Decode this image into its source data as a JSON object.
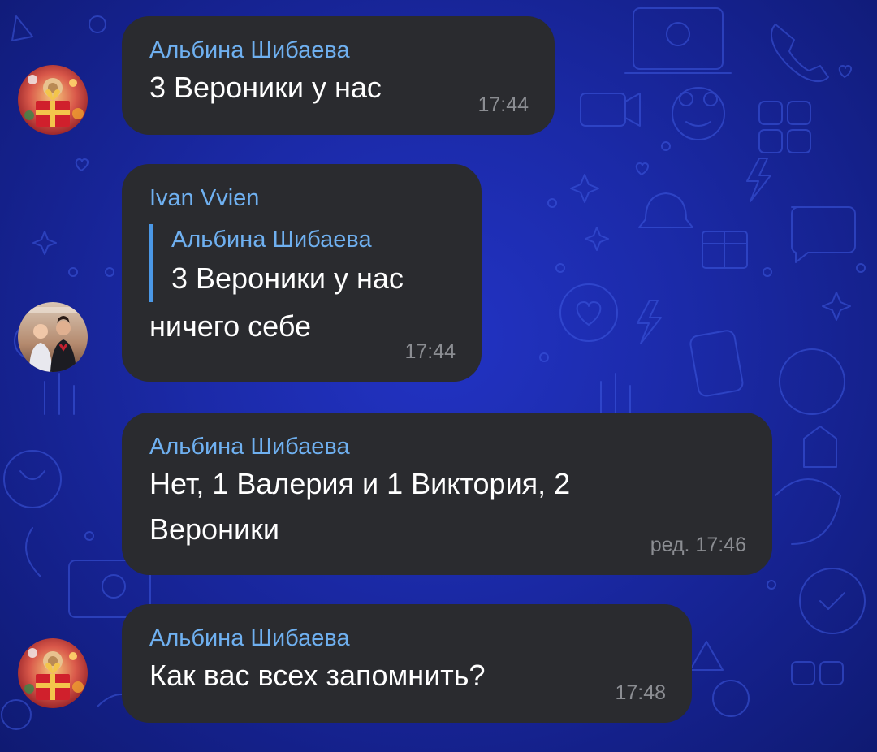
{
  "messages": [
    {
      "sender": "Альбина Шибаева",
      "text": "3 Вероники у нас",
      "time": "17:44",
      "avatar_icon": "gift-avatar-icon"
    },
    {
      "sender": "Ivan Vvien",
      "reply_to": {
        "sender": "Альбина Шибаева",
        "text": "3 Вероники у нас"
      },
      "text": "ничего себе",
      "time": "17:44",
      "avatar_icon": "couple-photo-avatar"
    },
    {
      "sender": "Альбина Шибаева",
      "text_line1": "Нет, 1 Валерия и 1 Виктория, 2",
      "text_line2": "Вероники",
      "time": "ред. 17:46"
    },
    {
      "sender": "Альбина Шибаева",
      "text": "Как вас всех запомнить?",
      "time": "17:48",
      "avatar_icon": "gift-avatar-icon"
    }
  ],
  "colors": {
    "background": "#1b2aa8",
    "bubble": "#2a2b2f",
    "sender": "#6fb0f0",
    "reply_bar": "#4b98e6",
    "time": "#8b8d92"
  }
}
